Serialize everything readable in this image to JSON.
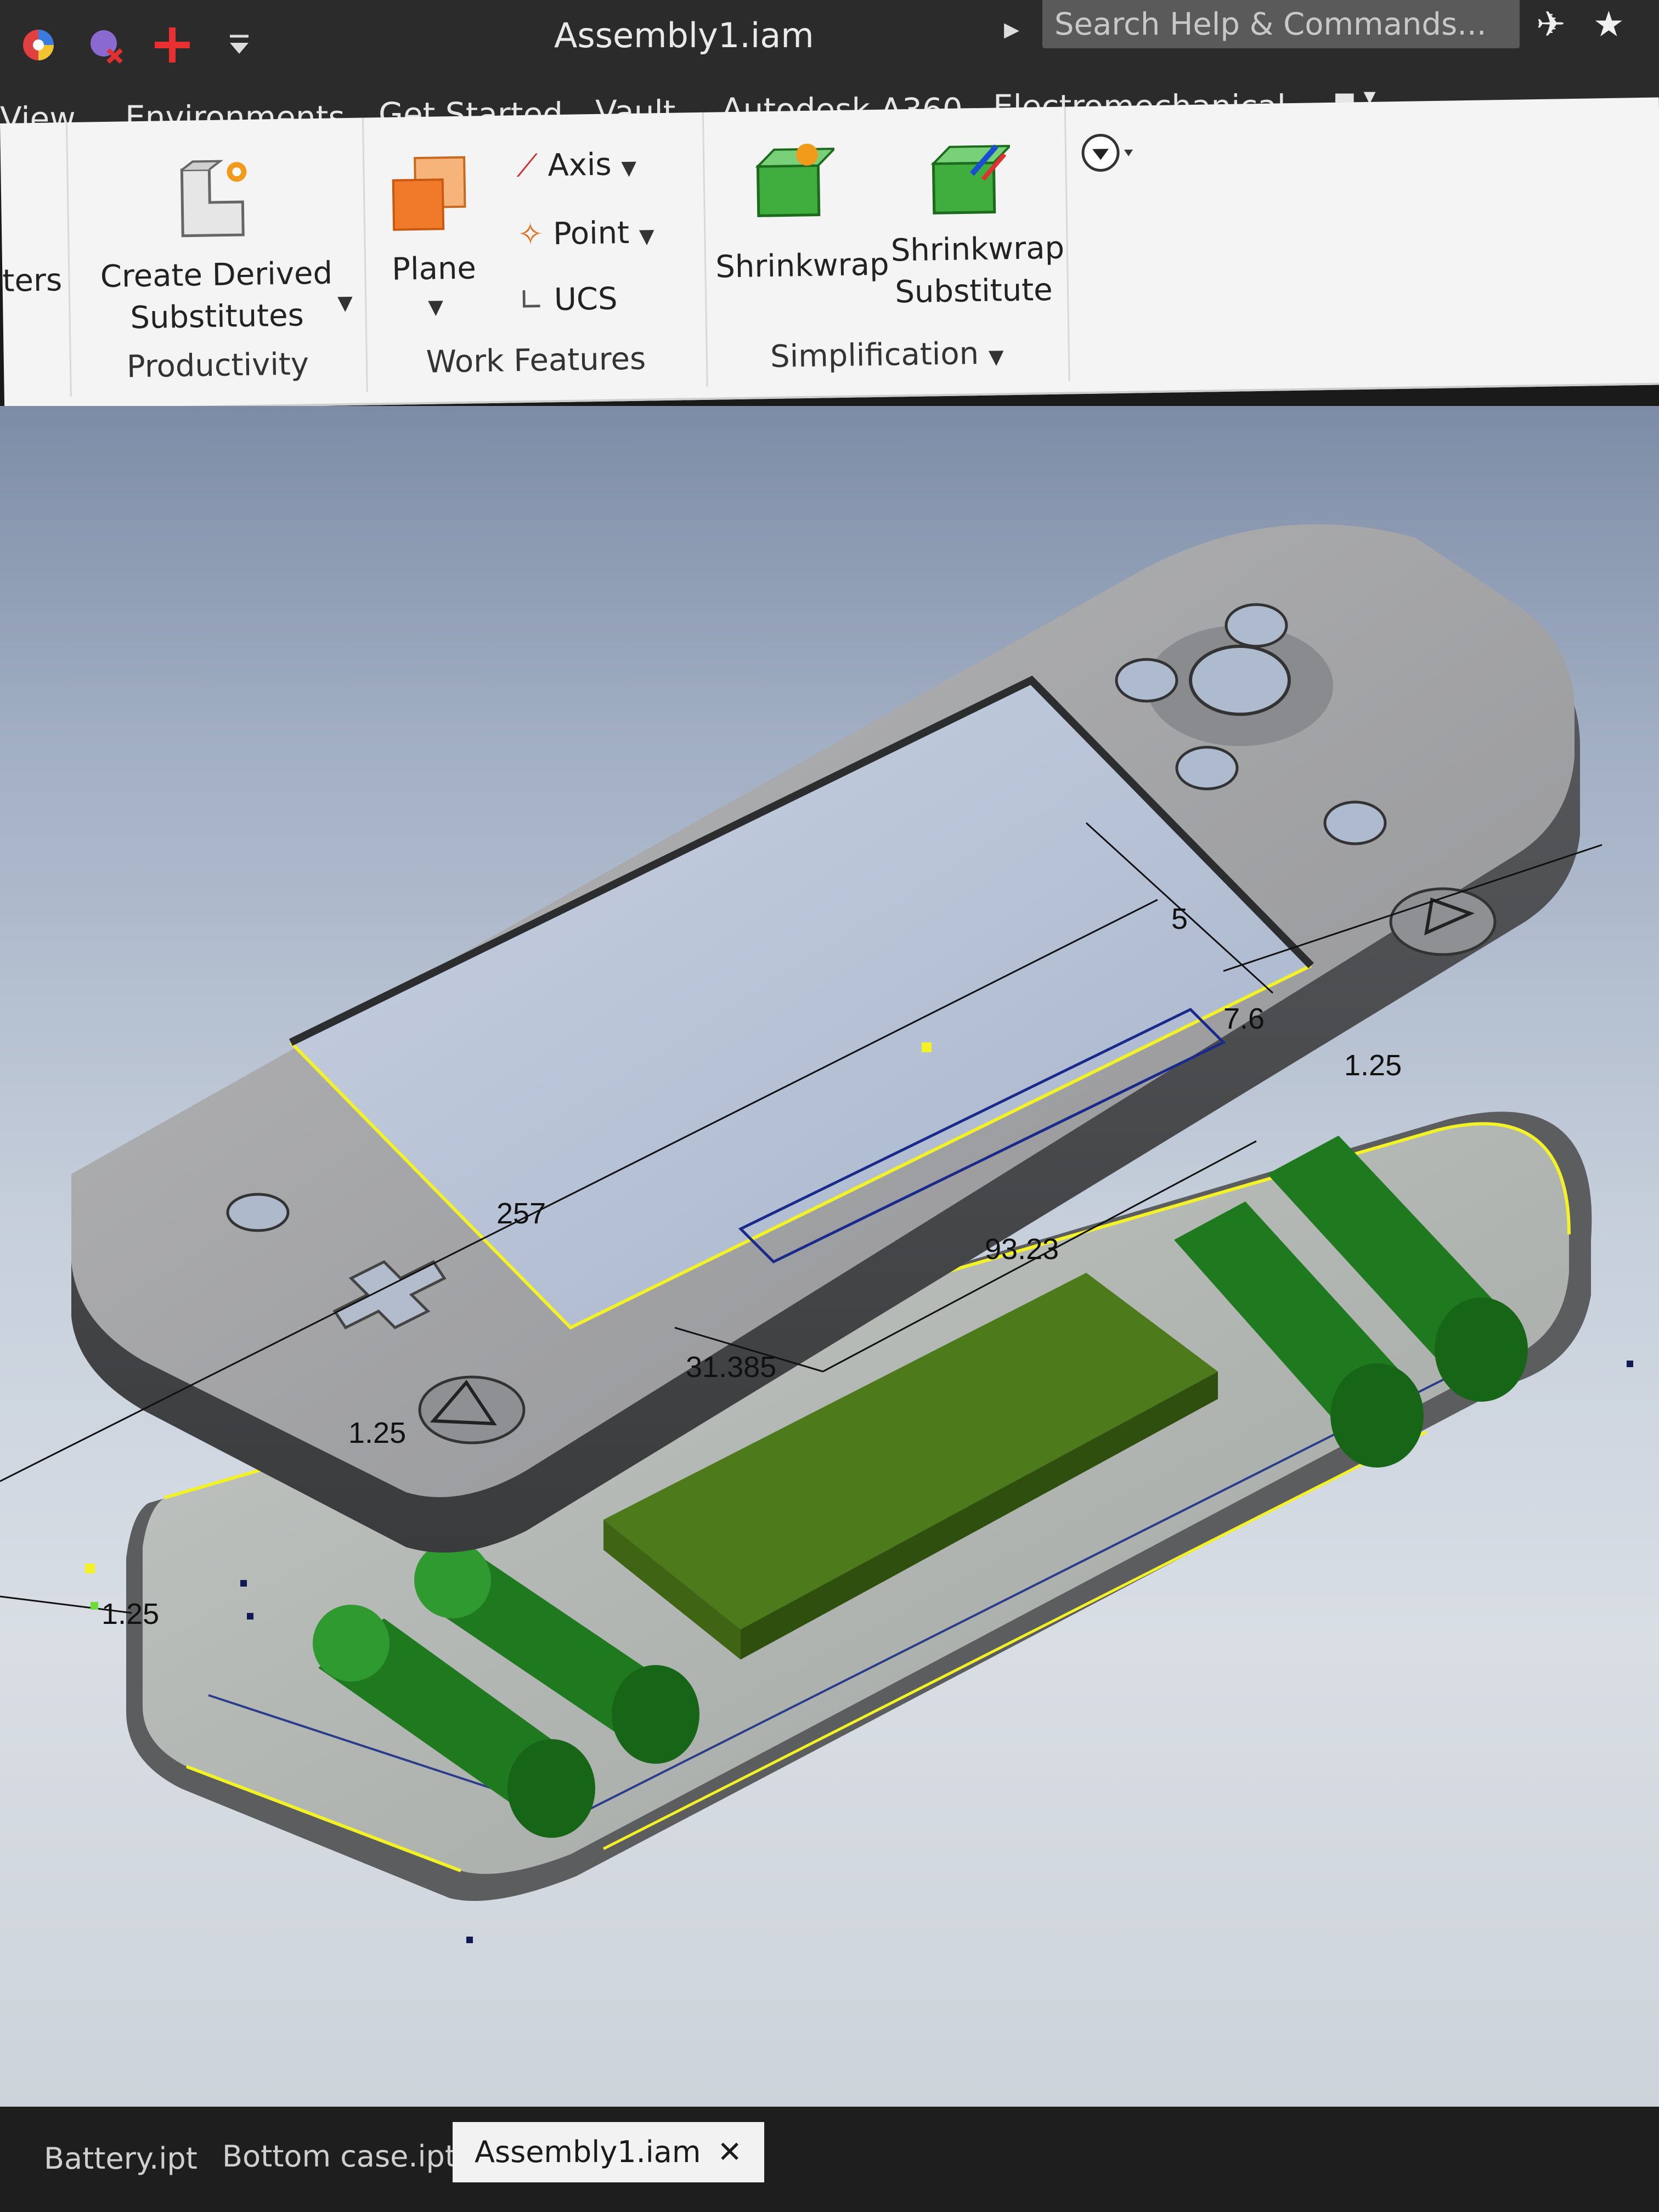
{
  "app": {
    "title": "Assembly1.iam"
  },
  "search": {
    "placeholder": "Search Help & Commands..."
  },
  "tabs": [
    "View",
    "Environments",
    "Get Started",
    "Vault",
    "Autodesk A360",
    "Electromechanical"
  ],
  "ribbon": {
    "cut_label": "ters",
    "productivity": {
      "title": "Productivity",
      "create_derived_line1": "Create Derived",
      "create_derived_line2": "Substitutes"
    },
    "work_features": {
      "title": "Work Features",
      "plane": "Plane",
      "axis": "Axis",
      "point": "Point",
      "ucs": "UCS"
    },
    "simplification": {
      "title": "Simplification",
      "shrinkwrap": "Shrinkwrap",
      "shrinkwrap_sub_line1": "Shrinkwrap",
      "shrinkwrap_sub_line2": "Substitute"
    }
  },
  "dimensions": {
    "d257": "257",
    "d5": "5",
    "d7_6": "7.6",
    "d1_25": "1.25",
    "d93_23": "93.23",
    "d31_385": "31.385"
  },
  "document_tabs": [
    {
      "label": "Battery.ipt"
    },
    {
      "label": "Bottom case.ipt"
    },
    {
      "label": "Assembly1.iam"
    }
  ],
  "colors": {
    "ribbon_bg": "#f4f4f4",
    "title_bg": "#2b2b2b",
    "battery_green": "#1f7a1f",
    "board_green": "#4d7a1a",
    "case_gray": "#9b9c9e",
    "highlight_yellow": "#f2f226"
  },
  "icons": [
    "color-wheel-icon",
    "color-clear-icon",
    "plus-icon",
    "qat-dropdown-icon",
    "sign-in-icon",
    "favorites-icon",
    "shrinkwrap-icon",
    "plane-icon",
    "axis-icon",
    "point-icon",
    "ucs-icon",
    "create-derived-icon",
    "navigation-icon",
    "close-icon"
  ]
}
